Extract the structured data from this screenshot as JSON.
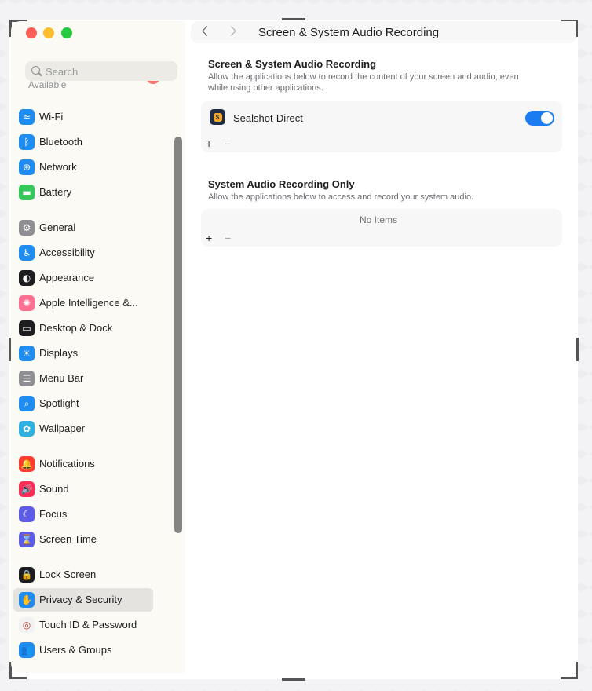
{
  "window": {
    "title": "Screen & System Audio Recording"
  },
  "search": {
    "placeholder": "Search"
  },
  "sidebar": {
    "available_label": "Available",
    "items": [
      {
        "label": "Wi-Fi",
        "icon": "wifi-icon",
        "color": "#1e8cf0",
        "glyph": "≈"
      },
      {
        "label": "Bluetooth",
        "icon": "bluetooth-icon",
        "color": "#1e8cf0",
        "glyph": "ᛒ"
      },
      {
        "label": "Network",
        "icon": "globe-icon",
        "color": "#1e8cf0",
        "glyph": "⊕"
      },
      {
        "label": "Battery",
        "icon": "battery-icon",
        "color": "#34c759",
        "glyph": "▬"
      },
      {
        "label": "General",
        "icon": "gear-icon",
        "color": "#8e8e93",
        "glyph": "⚙"
      },
      {
        "label": "Accessibility",
        "icon": "accessibility-icon",
        "color": "#1e8cf0",
        "glyph": "♿"
      },
      {
        "label": "Appearance",
        "icon": "appearance-icon",
        "color": "#1d1d1f",
        "glyph": "◐"
      },
      {
        "label": "Apple Intelligence &...",
        "icon": "apple-intelligence-icon",
        "color": "#ff6f91",
        "glyph": "✺"
      },
      {
        "label": "Desktop & Dock",
        "icon": "dock-icon",
        "color": "#1d1d1f",
        "glyph": "▭"
      },
      {
        "label": "Displays",
        "icon": "sun-icon",
        "color": "#1e8cf0",
        "glyph": "☀"
      },
      {
        "label": "Menu Bar",
        "icon": "menu-bar-icon",
        "color": "#8e8e93",
        "glyph": "☰"
      },
      {
        "label": "Spotlight",
        "icon": "magnifier-icon",
        "color": "#1e8cf0",
        "glyph": "⌕"
      },
      {
        "label": "Wallpaper",
        "icon": "flower-icon",
        "color": "#30b0e0",
        "glyph": "✿"
      },
      {
        "label": "Notifications",
        "icon": "bell-icon",
        "color": "#ff3b30",
        "glyph": "🔔"
      },
      {
        "label": "Sound",
        "icon": "speaker-icon",
        "color": "#ff2d55",
        "glyph": "🔊"
      },
      {
        "label": "Focus",
        "icon": "moon-icon",
        "color": "#5e5ce6",
        "glyph": "☾"
      },
      {
        "label": "Screen Time",
        "icon": "hourglass-icon",
        "color": "#5e5ce6",
        "glyph": "⌛"
      },
      {
        "label": "Lock Screen",
        "icon": "lock-icon",
        "color": "#1d1d1f",
        "glyph": "🔒"
      },
      {
        "label": "Privacy & Security",
        "icon": "hand-icon",
        "color": "#1e8cf0",
        "glyph": "✋",
        "selected": true
      },
      {
        "label": "Touch ID & Password",
        "icon": "fingerprint-icon",
        "color": "#f2f2f2",
        "glyph": "◎"
      },
      {
        "label": "Users & Groups",
        "icon": "users-icon",
        "color": "#1e8cf0",
        "glyph": "👥"
      }
    ]
  },
  "main": {
    "section1": {
      "title": "Screen & System Audio Recording",
      "desc_line1": "Allow the applications below to record the content of your screen and audio, even",
      "desc_line2": "while using other applications.",
      "apps": [
        {
          "name": "Sealshot-Direct",
          "enabled": true,
          "icon": "sealshot-app-icon"
        }
      ],
      "add_label": "+",
      "remove_label": "−"
    },
    "section2": {
      "title": "System Audio Recording Only",
      "desc": "Allow the applications below to access and record your system audio.",
      "empty_label": "No Items",
      "add_label": "+",
      "remove_label": "−"
    }
  }
}
